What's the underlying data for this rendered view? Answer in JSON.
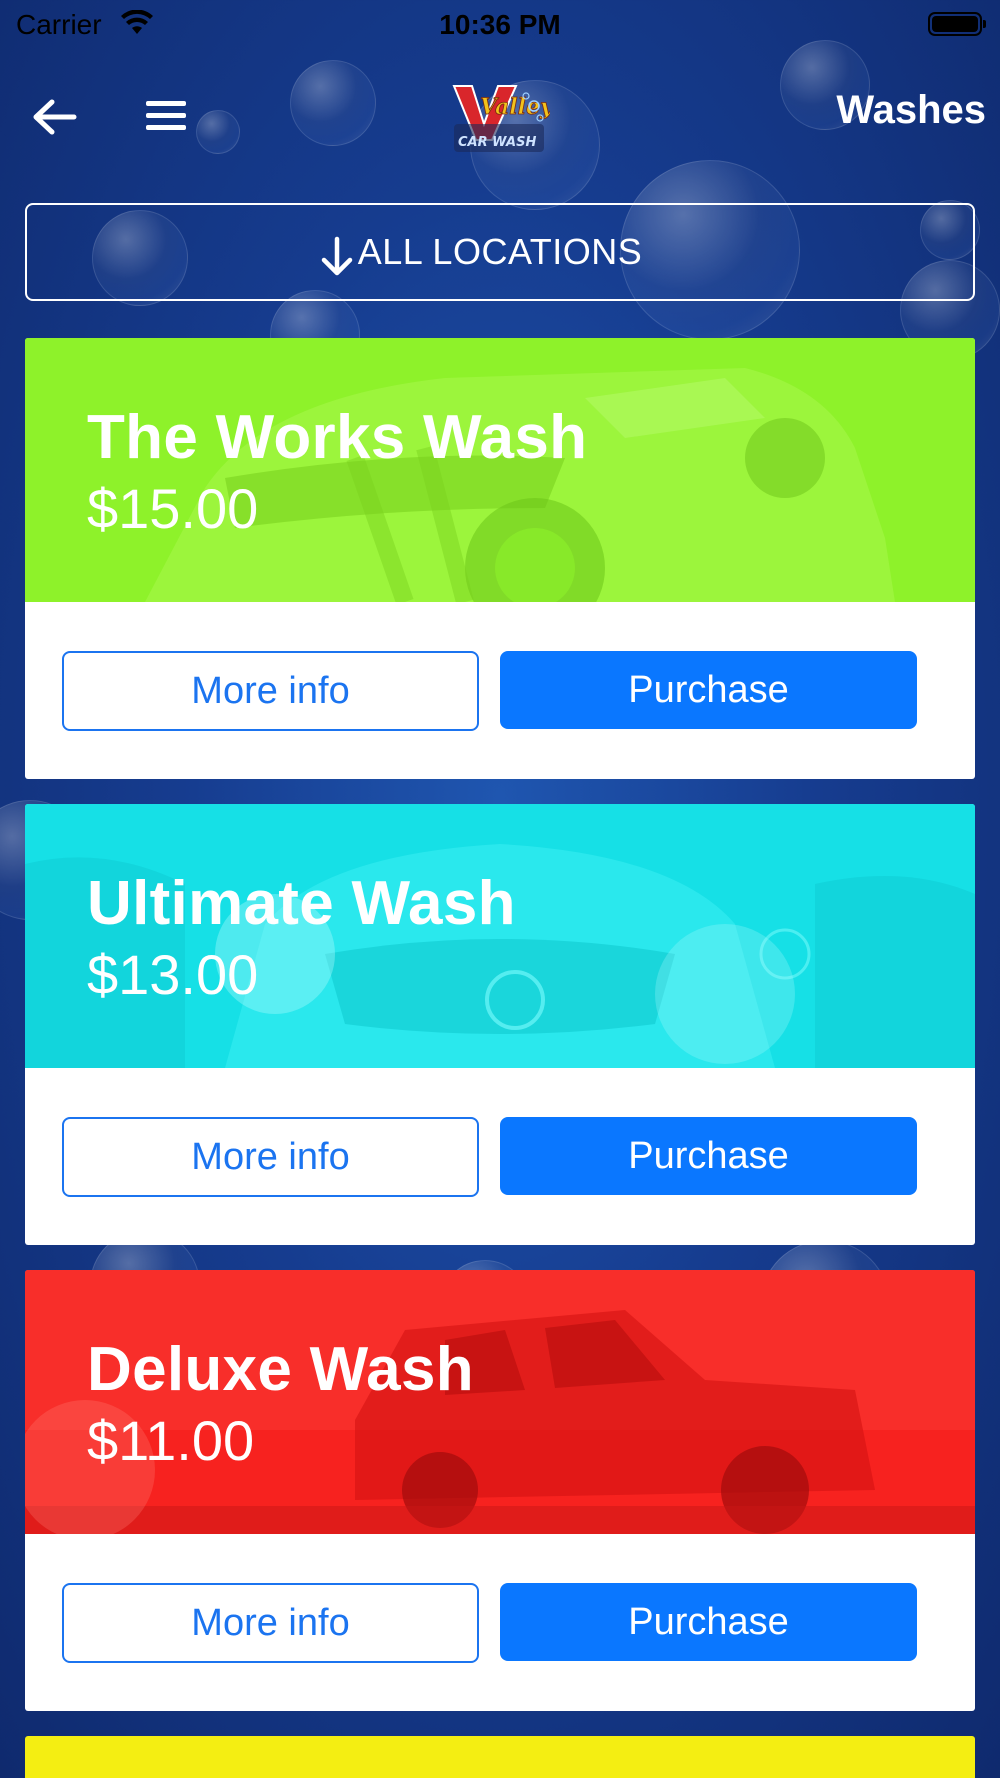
{
  "status_bar": {
    "carrier": "Carrier",
    "time": "10:36 PM"
  },
  "nav": {
    "title": "Washes",
    "logo_text_top": "Valley",
    "logo_text_bottom": "CAR WASH"
  },
  "location_selector": {
    "label": "ALL LOCATIONS"
  },
  "washes": [
    {
      "name": "The Works Wash",
      "price": "$15.00",
      "info_label": "More info",
      "purchase_label": "Purchase",
      "color": "#8ef22a"
    },
    {
      "name": "Ultimate Wash",
      "price": "$13.00",
      "info_label": "More info",
      "purchase_label": "Purchase",
      "color": "#16e0e6"
    },
    {
      "name": "Deluxe Wash",
      "price": "$11.00",
      "info_label": "More info",
      "purchase_label": "Purchase",
      "color": "#f7221f"
    }
  ],
  "next_card_color": "#f4ee12",
  "colors": {
    "primary_button": "#0a77ff",
    "outline_button": "#1b74f0"
  }
}
